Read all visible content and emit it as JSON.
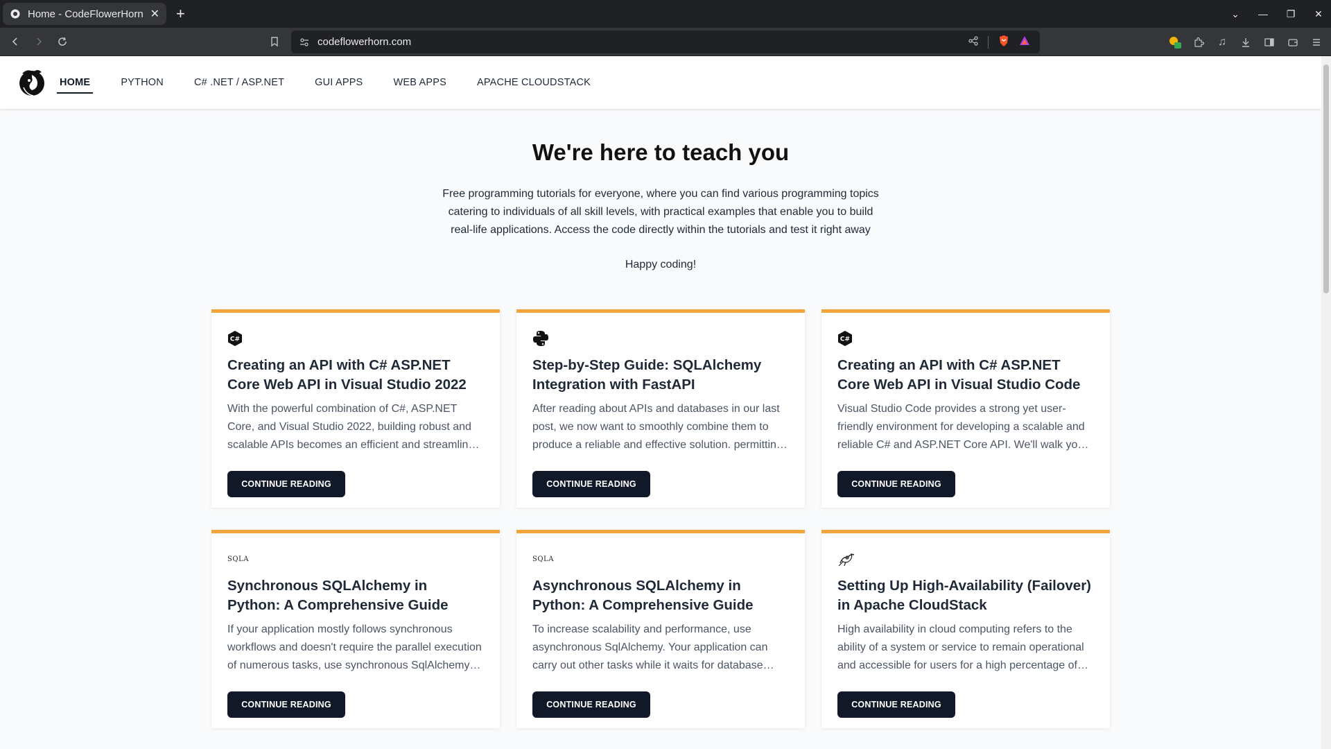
{
  "browser": {
    "tab_title": "Home - CodeFlowerHorn",
    "url": "codeflowerhorn.com"
  },
  "site": {
    "nav": [
      {
        "label": "HOME",
        "active": true
      },
      {
        "label": "PYTHON"
      },
      {
        "label": "C# .NET / ASP.NET"
      },
      {
        "label": "GUI APPS"
      },
      {
        "label": "WEB APPS"
      },
      {
        "label": "APACHE CLOUDSTACK"
      }
    ],
    "hero": {
      "title": "We're here to teach you",
      "intro": "Free programming tutorials for everyone, where you can find various programming topics catering to individuals of all skill levels, with practical examples that enable you to build real-life applications. Access the code directly within the tutorials and test it right away",
      "happy": "Happy coding!"
    },
    "accent_color": "#f2a33a",
    "cards": [
      {
        "icon": "csharp-icon",
        "title": "Creating an API with C# ASP.NET Core Web API in Visual Studio 2022",
        "excerpt": "With the powerful combination of C#, ASP.NET Core, and Visual Studio 2022, building robust and scalable APIs becomes an efficient and streamlin…",
        "button": "CONTINUE READING"
      },
      {
        "icon": "python-icon",
        "title": "Step-by-Step Guide: SQLAlchemy Integration with FastAPI",
        "excerpt": "After reading about APIs and databases in our last post, we now want to smoothly combine them to produce a reliable and effective solution. permittin…",
        "button": "CONTINUE READING"
      },
      {
        "icon": "csharp-icon",
        "title": "Creating an API with C# ASP.NET Core Web API in Visual Studio Code",
        "excerpt": "Visual Studio Code provides a strong yet user-friendly environment for developing a scalable and reliable C# and ASP.NET Core API. We'll walk yo…",
        "button": "CONTINUE READING"
      },
      {
        "icon": "sqlalchemy-icon",
        "icon_text": "SQLA",
        "title": "Synchronous SQLAlchemy in Python: A Comprehensive Guide",
        "excerpt": "If your application mostly follows synchronous workflows and doesn't require the parallel execution of numerous tasks, use synchronous SqlAlchemy…",
        "button": "CONTINUE READING"
      },
      {
        "icon": "sqlalchemy-icon",
        "icon_text": "SQLA",
        "title": "Asynchronous SQLAlchemy in Python: A Comprehensive Guide",
        "excerpt": "To increase scalability and performance, use asynchronous SqlAlchemy. Your application can carry out other tasks while it waits for database…",
        "button": "CONTINUE READING"
      },
      {
        "icon": "cloudstack-icon",
        "title": "Setting Up High-Availability (Failover) in Apache CloudStack",
        "excerpt": "High availability in cloud computing refers to the ability of a system or service to remain operational and accessible for users for a high percentage of…",
        "button": "CONTINUE READING"
      }
    ]
  }
}
